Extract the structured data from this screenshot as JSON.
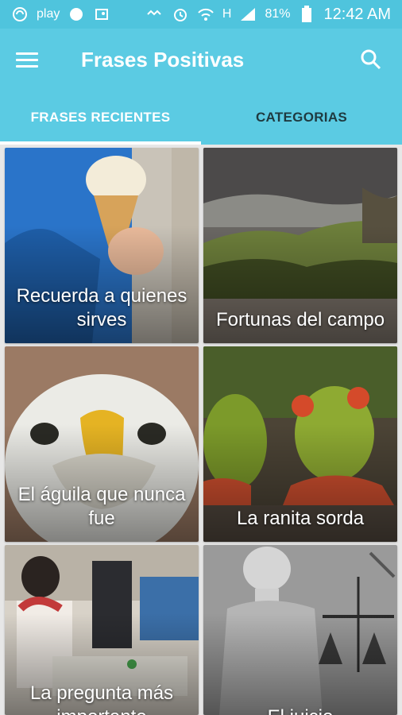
{
  "status_bar": {
    "battery": "81%",
    "time": "12:42 AM",
    "play_label": "play",
    "network_label": "H"
  },
  "app_bar": {
    "title": "Frases Positivas"
  },
  "tabs": [
    {
      "label": "FRASES RECIENTES",
      "active": true
    },
    {
      "label": "CATEGORIAS",
      "active": false
    }
  ],
  "cards": [
    {
      "title": "Recuerda a quienes sirves"
    },
    {
      "title": "Fortunas del campo"
    },
    {
      "title": "El águila que nunca fue"
    },
    {
      "title": "La ranita sorda"
    },
    {
      "title": "La pregunta más importante"
    },
    {
      "title": "El juicio"
    }
  ],
  "colors": {
    "primary": "#5bcbe3",
    "status_bar": "#4fc4dd",
    "tab_indicator": "#ffffff"
  }
}
